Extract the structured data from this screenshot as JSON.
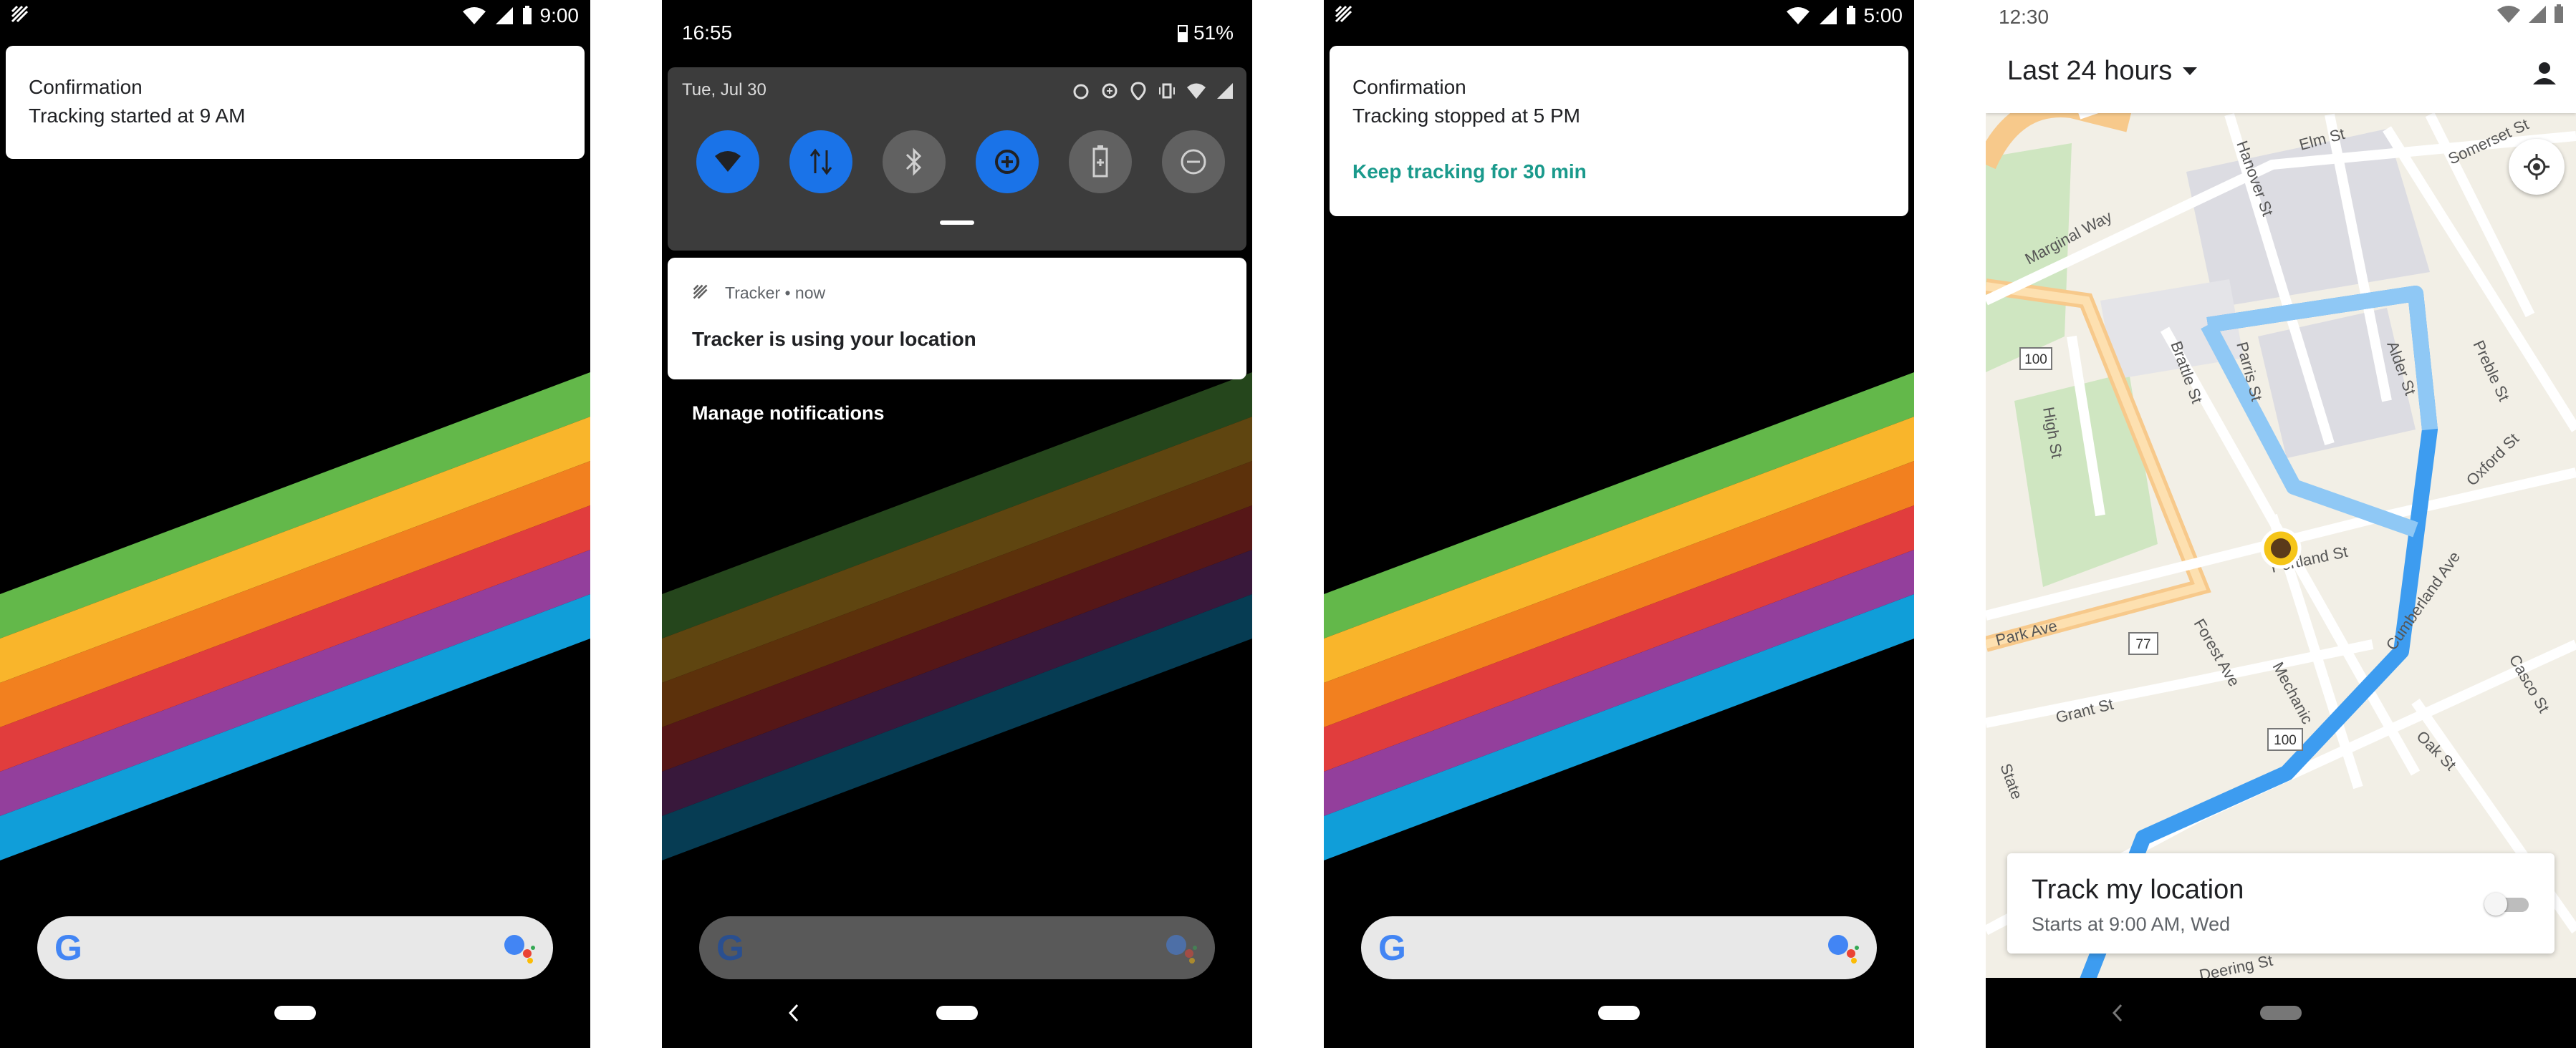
{
  "phone1": {
    "status_time": "9:00",
    "notification": {
      "title": "Confirmation",
      "body": "Tracking started at 9 AM"
    }
  },
  "phone2": {
    "status_time": "16:55",
    "battery": "51%",
    "qs_date": "Tue, Jul 30",
    "notification": {
      "app": "Tracker • now",
      "body": "Tracker is using your location"
    },
    "manage": "Manage notifications"
  },
  "phone3": {
    "status_time": "5:00",
    "notification": {
      "title": "Confirmation",
      "body": "Tracking stopped at 5 PM",
      "action": "Keep tracking for 30 min"
    }
  },
  "phone4": {
    "status_time": "12:30",
    "range_label": "Last 24 hours",
    "street_labels": [
      "Marginal Way",
      "Elm St",
      "Somerset St",
      "Hanover St",
      "Preble St",
      "Oxford St",
      "Brattle St",
      "Parris St",
      "High St",
      "Portland St",
      "Park Ave",
      "Forest Ave",
      "Mechanic",
      "Grant St",
      "Oak St",
      "State",
      "Casco St",
      "Alder St",
      "Deering St",
      "Cumberland Ave"
    ],
    "route_shields": [
      "100",
      "77",
      "100"
    ],
    "card_title": "Track my location",
    "card_sub": "Starts at 9:00 AM, Wed",
    "toggle_on": false
  },
  "colors": {
    "accent_teal": "#1a9a8c",
    "qs_blue": "#1a73e8",
    "stripe_green": "#63b84a",
    "stripe_yellow": "#f9b52b",
    "stripe_orange": "#f2801f",
    "stripe_red": "#e13d3d",
    "stripe_purple": "#933f9c",
    "stripe_blue": "#109ed9",
    "route_blue": "#3d9cf0"
  }
}
